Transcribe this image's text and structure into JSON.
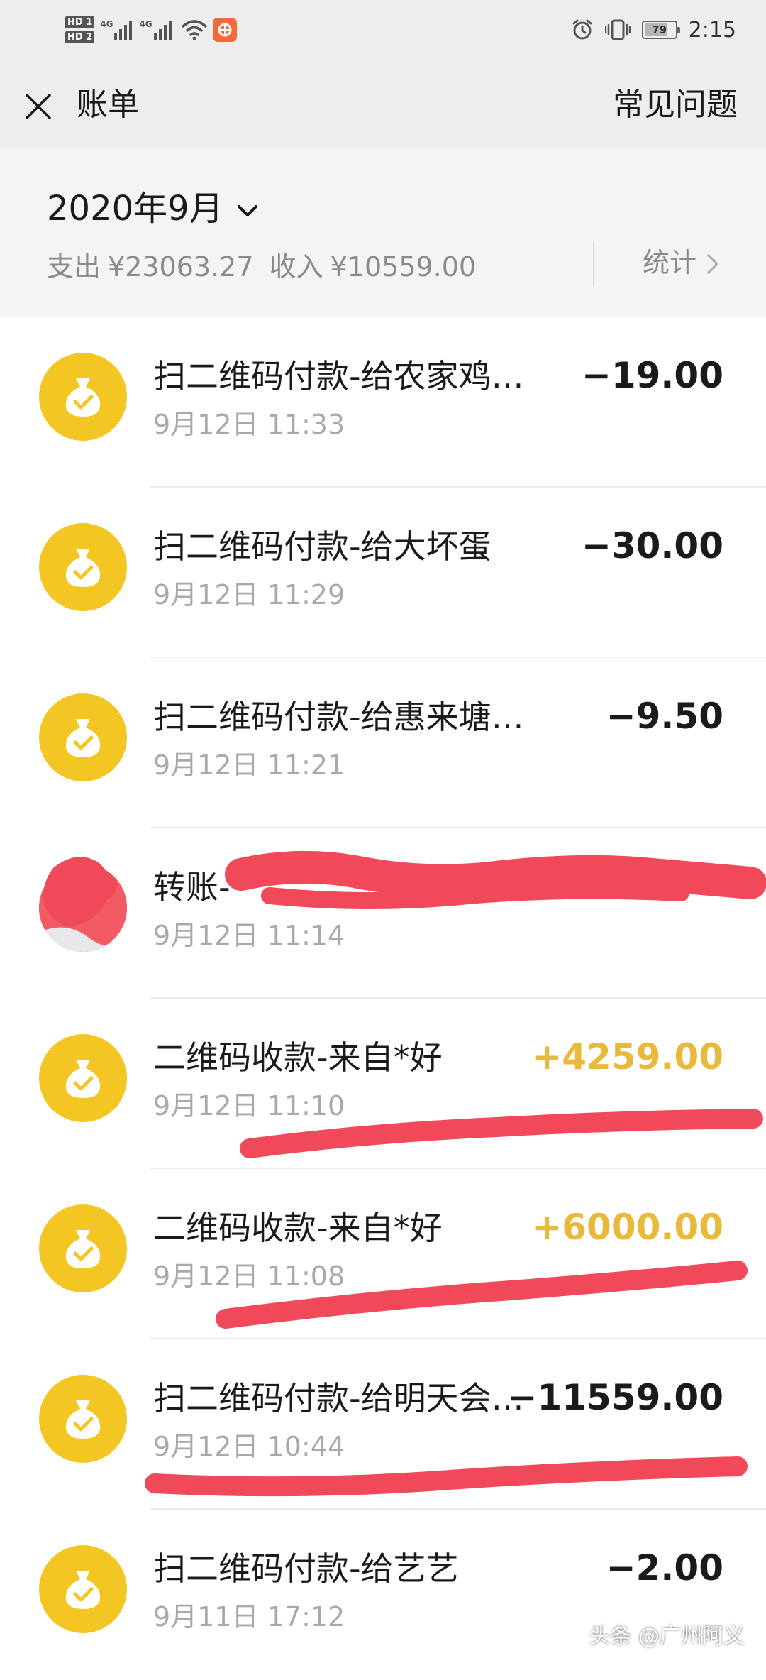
{
  "status_bar": {
    "hd1": "HD 1",
    "hd2": "HD 2",
    "net1": "4G",
    "net2": "4G",
    "battery": "79",
    "time": "2:15",
    "icons": [
      "signal-icon",
      "wifi-icon",
      "app-notification-icon",
      "alarm-icon",
      "vibrate-icon",
      "battery-icon"
    ]
  },
  "nav": {
    "title": "账单",
    "faq": "常见问题",
    "close_icon": "close-icon"
  },
  "header": {
    "month": "2020年9月",
    "expense_label": "支出",
    "expense": "¥23063.27",
    "income_label": "收入",
    "income": "¥10559.00",
    "stats": "统计"
  },
  "bills": [
    {
      "title": "扫二维码付款-给农家鸡…",
      "time": "9月12日 11:33",
      "amount": "−19.00",
      "type": "expense",
      "icon": "money-bag-icon"
    },
    {
      "title": "扫二维码付款-给大坏蛋",
      "time": "9月12日 11:29",
      "amount": "−30.00",
      "type": "expense",
      "icon": "money-bag-icon"
    },
    {
      "title": "扫二维码付款-给惠来塘…",
      "time": "9月12日 11:21",
      "amount": "−9.50",
      "type": "expense",
      "icon": "money-bag-icon"
    },
    {
      "title": "转账-",
      "time": "9月12日 11:14",
      "amount": "",
      "type": "expense",
      "icon": "avatar"
    },
    {
      "title": "二维码收款-来自*好",
      "time": "9月12日 11:10",
      "amount": "+4259.00",
      "type": "income",
      "icon": "money-bag-icon"
    },
    {
      "title": "二维码收款-来自*好",
      "time": "9月12日 11:08",
      "amount": "+6000.00",
      "type": "income",
      "icon": "money-bag-icon"
    },
    {
      "title": "扫二维码付款-给明天会…",
      "time": "9月12日 10:44",
      "amount": "−11559.00",
      "type": "expense",
      "icon": "money-bag-icon"
    },
    {
      "title": "扫二维码付款-给艺艺",
      "time": "9月11日 17:12",
      "amount": "−2.00",
      "type": "expense",
      "icon": "money-bag-icon"
    }
  ],
  "colors": {
    "icon_yellow": "#f3c623",
    "income": "#e8b93a",
    "redaction": "#f04a5a"
  },
  "watermark": "头条 @广州阿义"
}
